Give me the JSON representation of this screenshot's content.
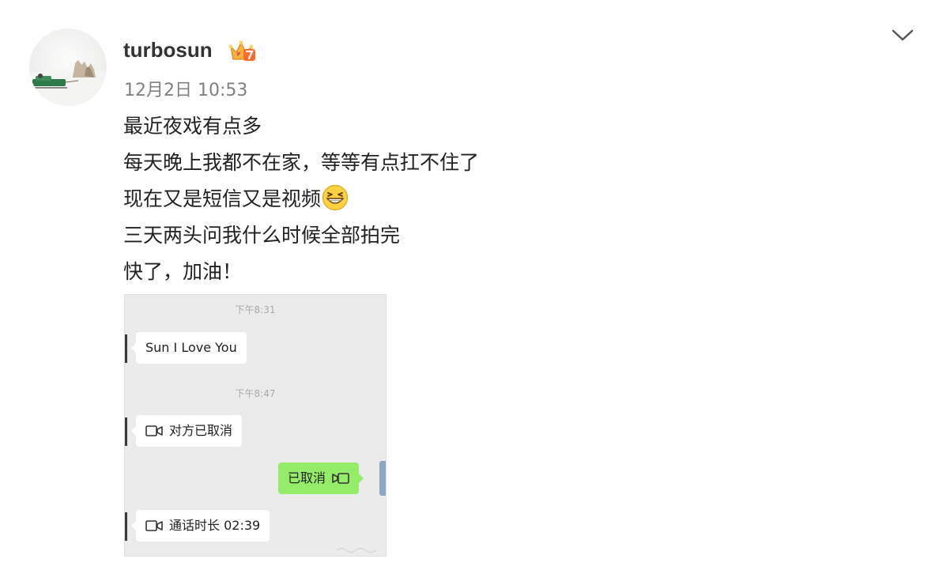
{
  "post": {
    "username": "turbosun",
    "timestamp": "12月2日 10:53",
    "lines": [
      "最近夜戏有点多",
      "每天晚上我都不在家，等等有点扛不住了",
      "现在又是短信又是视频",
      "三天两头问我什么时候全部拍完",
      "快了，加油！"
    ]
  },
  "icons": {
    "vip": "crown-vip-icon",
    "menu": "chevron-down-icon",
    "emoji": "grin-emoji-icon",
    "video": "video-camera-icon"
  },
  "chat": {
    "time1": "下午8:31",
    "msg1": "Sun I Love You",
    "time2": "下午8:47",
    "msg2": "对方已取消",
    "msg3": "已取消",
    "msg4": "通话时长 02:39"
  },
  "colors": {
    "username": "#333333",
    "timestamp": "#808080",
    "chat_bg": "#ebebeb",
    "bubble_self": "#95ec69",
    "vip_badge": "#f5a623"
  }
}
